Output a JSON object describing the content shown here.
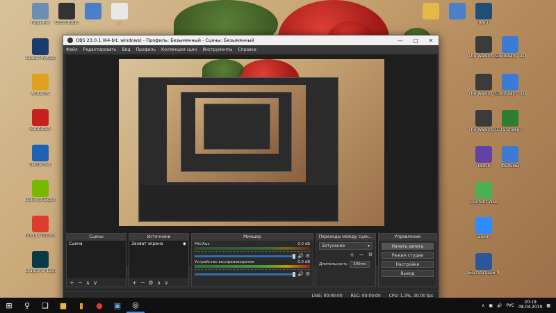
{
  "desktop": {
    "left_icons": [
      {
        "label": "Корзина",
        "icon": "recycle-bin-icon",
        "color": "#6b8fb3"
      },
      {
        "label": "Adobe Photosh...",
        "icon": "photoshop-icon",
        "color": "#1b3b6f"
      },
      {
        "label": "Audacity",
        "icon": "audacity-icon",
        "color": "#e0a020"
      },
      {
        "label": "Bandicam",
        "icon": "bandicam-icon",
        "color": "#c81e1e"
      },
      {
        "label": "Battle.net",
        "icon": "battlenet-icon",
        "color": "#1c62b8"
      },
      {
        "label": "GeForce Experience",
        "icon": "geforce-icon",
        "color": "#76b900"
      },
      {
        "label": "Google Chrome",
        "icon": "chrome-icon",
        "color": "#dc3d2c"
      },
      {
        "label": "League of Legends",
        "icon": "league-icon",
        "color": "#0a3a4a"
      }
    ],
    "top_icons": [
      {
        "label": "OBS Studio",
        "icon": "obs-icon",
        "color": "#333333"
      },
      {
        "label": "",
        "icon": "image-file-icon",
        "color": "#4a7fc9"
      },
      {
        "label": "...",
        "icon": "document-icon",
        "color": "#e8e8e8"
      }
    ],
    "right_icons": [
      {
        "label": "",
        "icon": "folder-icon",
        "color": "#e4b94a"
      },
      {
        "label": "",
        "icon": "image-file-icon",
        "color": "#4a7fc9"
      },
      {
        "label": "RAFT",
        "icon": "raft-icon",
        "color": "#1f4e79"
      },
      {
        "label": "videoplay... 3shake.web",
        "icon": "video-file-icon",
        "color": "#3a7bd5"
      },
      {
        "label": "The Walking Dead",
        "icon": "twd-icon",
        "color": "#3b3b3b"
      },
      {
        "label": "videoplay... 3shake.web",
        "icon": "video-file-icon",
        "color": "#3a7bd5"
      },
      {
        "label": "The Walking Dead - The...",
        "icon": "twd-icon",
        "color": "#3b3b3b"
      },
      {
        "label": "The Walking Dead",
        "icon": "twd-icon",
        "color": "#3b3b3b"
      },
      {
        "label": "GTS Shake...",
        "icon": "shortcut-icon",
        "color": "#2e7d32"
      },
      {
        "label": "Twitch",
        "icon": "twitch-icon",
        "color": "#6441a5"
      },
      {
        "label": "Фильмы",
        "icon": "video-file-icon",
        "color": "#3a7bd5"
      },
      {
        "label": "uTorrent Web",
        "icon": "utorrent-icon",
        "color": "#4caf50"
      },
      {
        "label": "Zoom",
        "icon": "zoom-icon",
        "color": "#2d8cff"
      },
      {
        "label": "Бесплатный п...",
        "icon": "word-icon",
        "color": "#2b579a"
      }
    ]
  },
  "window": {
    "title": "OBS 23.0.1 (64-bit, windows) - Профиль: Безымянный - Сцены: Безымянный",
    "menu": [
      "Файл",
      "Редактировать",
      "Вид",
      "Профиль",
      "Коллекция сцен",
      "Инструменты",
      "Справка"
    ]
  },
  "docks": {
    "scenes": {
      "title": "Сцены",
      "items": [
        "Сцена"
      ]
    },
    "sources": {
      "title": "Источники",
      "items": [
        "Захват экрана"
      ]
    },
    "mixer": {
      "title": "Микшер",
      "tracks": [
        {
          "name": "Mic/Aux",
          "db": "0.0 dB"
        },
        {
          "name": "Устройство воспроизведения",
          "db": "0.0 dB"
        }
      ]
    },
    "transitions": {
      "title": "Переходы между сцен...",
      "type": "Затухание",
      "duration_label": "Длительность",
      "duration": "300ms"
    },
    "controls": {
      "title": "Управление",
      "buttons": [
        "Начать запись",
        "Режим студии",
        "Настройки",
        "Выход"
      ]
    }
  },
  "status": {
    "live": "LIVE: 00:00:00",
    "rec": "REC: 00:00:00",
    "cpu": "CPU: 1.3%, 30.00 fps"
  },
  "taskbar": {
    "lang": "РУС",
    "time": "20:19",
    "date": "08.04.2019"
  }
}
